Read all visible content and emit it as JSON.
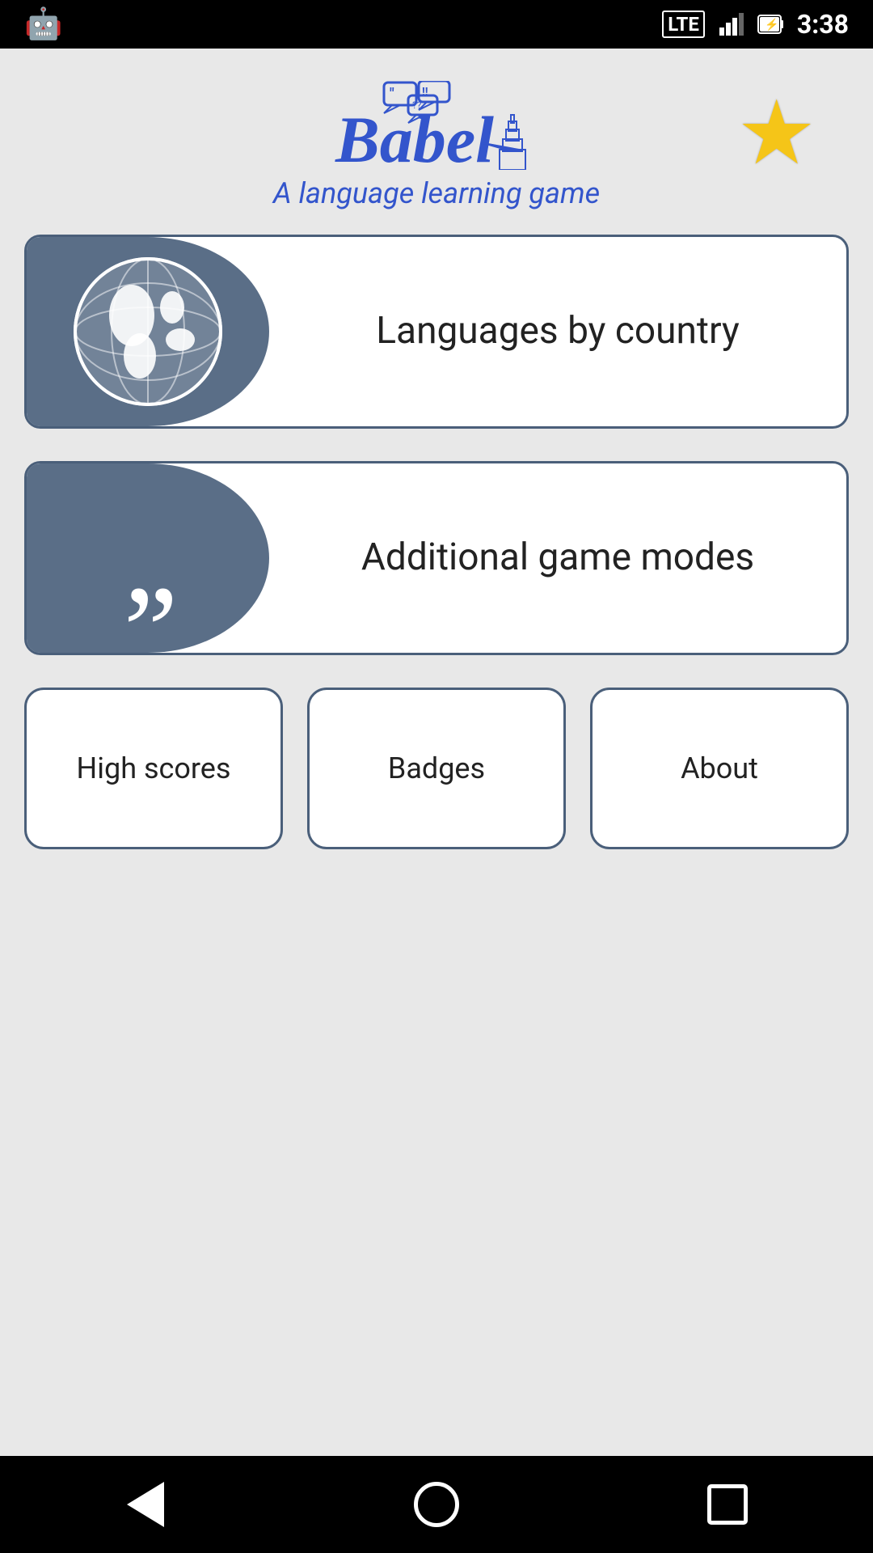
{
  "statusBar": {
    "time": "3:38",
    "lte": "LTE",
    "battery": "⚡",
    "signal": "📶"
  },
  "header": {
    "appName": "Babel",
    "tagline": "A language learning game",
    "starLabel": "★"
  },
  "menuCards": [
    {
      "id": "languages-by-country",
      "label": "Languages by\ncountry",
      "icon": "globe-icon"
    },
    {
      "id": "additional-game-modes",
      "label": "Additional game modes",
      "icon": "quotes-icon"
    }
  ],
  "bottomButtons": [
    {
      "id": "high-scores",
      "label": "High scores"
    },
    {
      "id": "badges",
      "label": "Badges"
    },
    {
      "id": "about",
      "label": "About"
    }
  ],
  "navbar": {
    "back": "back",
    "home": "home",
    "recent": "recent"
  }
}
